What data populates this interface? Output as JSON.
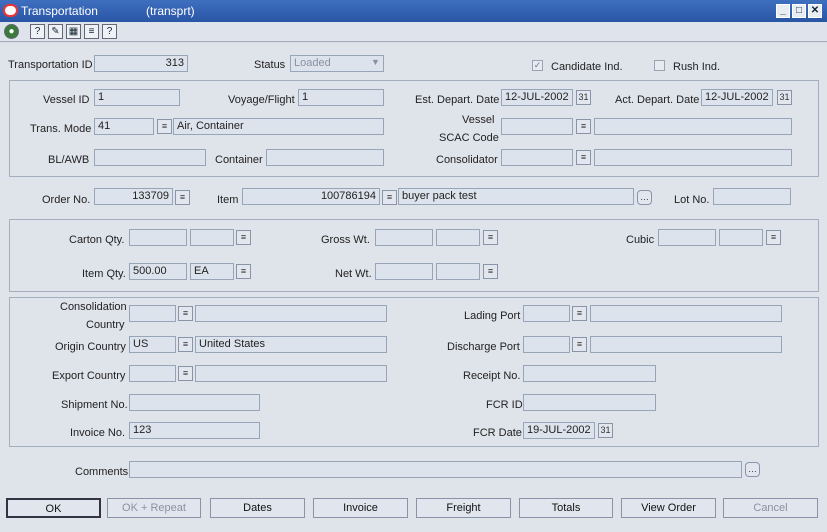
{
  "window": {
    "title": "Transportation",
    "subtitle": "(transprt)",
    "min": "_",
    "max": "□",
    "close": "✕"
  },
  "toolbar": {
    "icons": [
      "globe-icon",
      "help-icon",
      "tools-icon",
      "calculator-icon",
      "notes-icon",
      "question-icon"
    ]
  },
  "header": {
    "transportation_id_label": "Transportation ID",
    "transportation_id": "313",
    "status_label": "Status",
    "status": "Loaded",
    "candidate_label": "Candidate Ind.",
    "rush_label": "Rush Ind."
  },
  "vessel": {
    "vessel_id_label": "Vessel ID",
    "vessel_id": "1",
    "voyage_label": "Voyage/Flight",
    "voyage": "1",
    "est_depart_label": "Est. Depart. Date",
    "est_depart": "12-JUL-2002",
    "act_depart_label": "Act. Depart. Date",
    "act_depart": "12-JUL-2002",
    "trans_mode_label": "Trans. Mode",
    "trans_mode": "41",
    "trans_mode_desc": "Air, Container",
    "scac_label1": "Vessel",
    "scac_label2": "SCAC Code",
    "bl_label": "BL/AWB",
    "container_label": "Container",
    "consolidator_label": "Consolidator"
  },
  "order": {
    "order_label": "Order No.",
    "order": "133709",
    "item_label": "Item",
    "item": "100786194",
    "item_desc": "buyer pack test",
    "lot_label": "Lot No."
  },
  "qty": {
    "carton_label": "Carton Qty.",
    "gross_label": "Gross Wt.",
    "cubic_label": "Cubic",
    "item_qty_label": "Item Qty.",
    "item_qty": "500.00",
    "item_uom": "EA",
    "net_label": "Net Wt."
  },
  "location": {
    "consol_country_label1": "Consolidation",
    "consol_country_label2": "Country",
    "origin_label": "Origin Country",
    "origin": "US",
    "origin_desc": "United States",
    "export_label": "Export Country",
    "shipment_label": "Shipment No.",
    "invoice_label": "Invoice No.",
    "invoice": "123",
    "lading_label": "Lading Port",
    "discharge_label": "Discharge Port",
    "receipt_label": "Receipt No.",
    "fcr_id_label": "FCR ID",
    "fcr_date_label": "FCR Date",
    "fcr_date": "19-JUL-2002"
  },
  "comments": {
    "label": "Comments"
  },
  "buttons": {
    "ok": "OK",
    "ok_repeat": "OK + Repeat",
    "dates": "Dates",
    "invoice": "Invoice",
    "freight": "Freight",
    "totals": "Totals",
    "view_order": "View Order",
    "cancel": "Cancel"
  }
}
